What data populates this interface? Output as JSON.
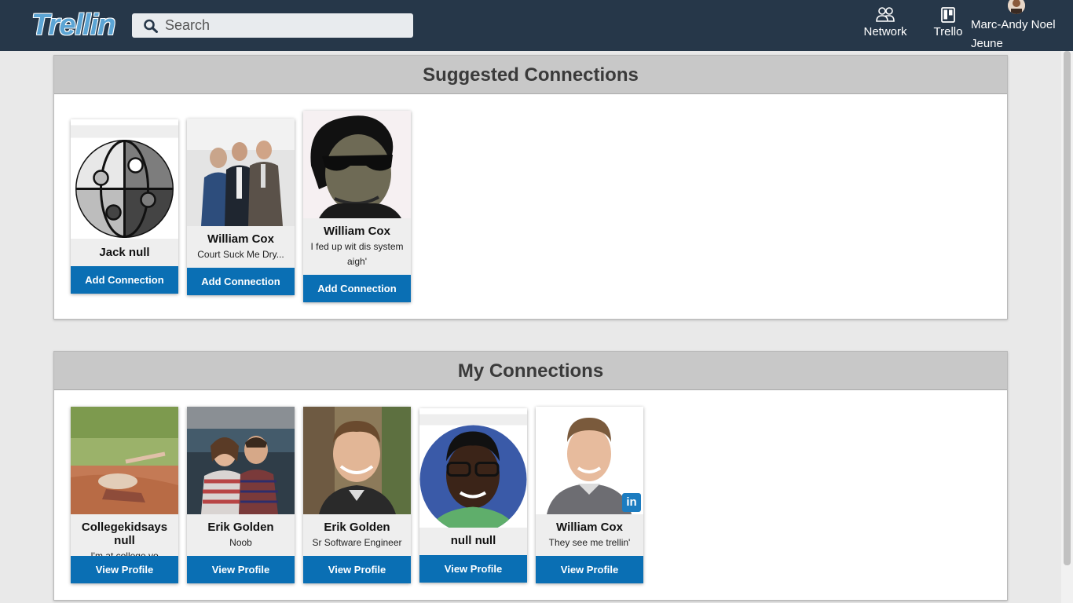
{
  "navbar": {
    "logo": "Trellin",
    "search_placeholder": "Search",
    "network_label": "Network",
    "trello_label": "Trello",
    "user_name": "Marc-Andy Noel Jeune"
  },
  "suggested": {
    "title": "Suggested Connections",
    "cards": [
      {
        "name": "Jack null",
        "tagline": "",
        "button": "Add Connection"
      },
      {
        "name": "William Cox",
        "tagline": "Court Suck Me Dry...",
        "button": "Add Connection"
      },
      {
        "name": "William Cox",
        "tagline": "I fed up wit dis system aigh'",
        "button": "Add Connection"
      }
    ]
  },
  "my_connections": {
    "title": "My Connections",
    "cards": [
      {
        "name": "Collegekidsays null",
        "tagline": "I'm at college yo",
        "button": "View Profile"
      },
      {
        "name": "Erik Golden",
        "tagline": "Noob",
        "button": "View Profile"
      },
      {
        "name": "Erik Golden",
        "tagline": "Sr Software Engineer",
        "button": "View Profile"
      },
      {
        "name": "null null",
        "tagline": "",
        "button": "View Profile"
      },
      {
        "name": "William Cox",
        "tagline": "They see me trellin'",
        "button": "View Profile"
      }
    ]
  },
  "colors": {
    "navbar": "#263749",
    "button": "#0a6fb4",
    "panel_header": "#c8c8c8"
  }
}
